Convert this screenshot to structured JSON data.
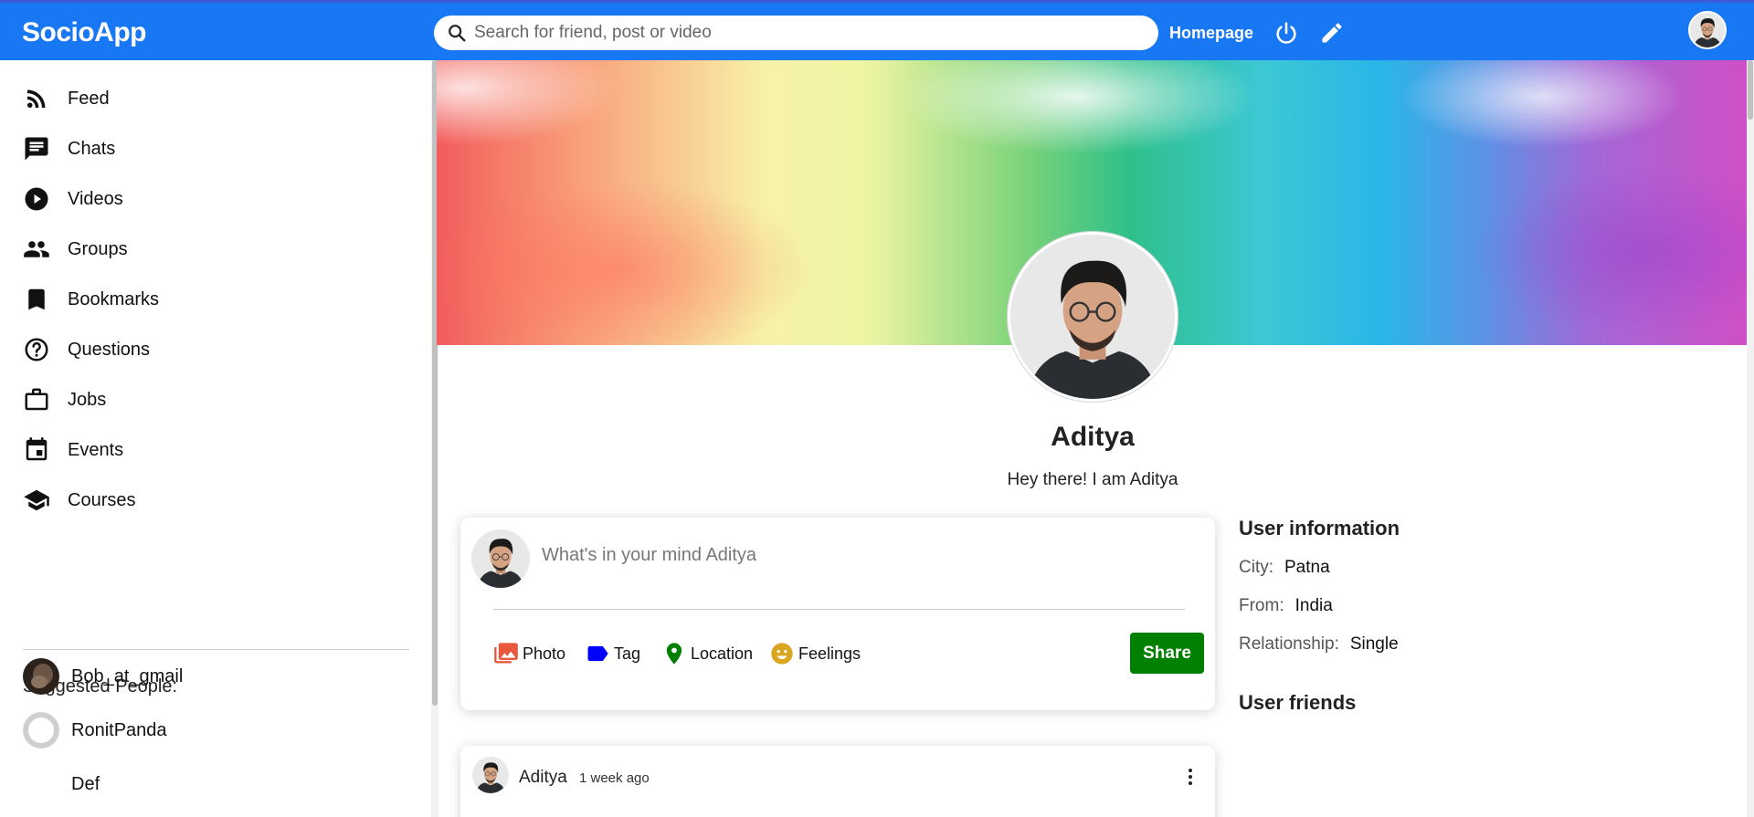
{
  "app": {
    "brand": "SocioApp",
    "search_placeholder": "Search for friend, post or video",
    "nav_link": "Homepage",
    "accent_color": "#1877f2"
  },
  "sidebar": {
    "items": [
      {
        "label": "Feed",
        "icon": "rss-feed-icon"
      },
      {
        "label": "Chats",
        "icon": "chat-icon"
      },
      {
        "label": "Videos",
        "icon": "play-circle-icon"
      },
      {
        "label": "Groups",
        "icon": "group-icon"
      },
      {
        "label": "Bookmarks",
        "icon": "bookmark-icon"
      },
      {
        "label": "Questions",
        "icon": "help-circle-icon"
      },
      {
        "label": "Jobs",
        "icon": "briefcase-icon"
      },
      {
        "label": "Events",
        "icon": "calendar-icon"
      },
      {
        "label": "Courses",
        "icon": "school-icon"
      }
    ],
    "suggested_title": "Suggested People:",
    "suggested": [
      {
        "name": "Bob_at_gmail"
      },
      {
        "name": "RonitPanda"
      },
      {
        "name": "Def"
      }
    ]
  },
  "profile": {
    "name": "Aditya",
    "bio": "Hey there! I am Aditya"
  },
  "share": {
    "placeholder": "What's in your mind Aditya",
    "options": [
      {
        "label": "Photo",
        "icon": "photo-icon",
        "color": "#e9573f"
      },
      {
        "label": "Tag",
        "icon": "tag-icon",
        "color": "#0000ff"
      },
      {
        "label": "Location",
        "icon": "location-pin-icon",
        "color": "#008000"
      },
      {
        "label": "Feelings",
        "icon": "emoji-icon",
        "color": "#daa520"
      }
    ],
    "button": "Share",
    "button_color": "#008000"
  },
  "post": {
    "user": "Aditya",
    "time": "1 week ago"
  },
  "user_info": {
    "title": "User information",
    "fields": [
      {
        "key": "City:",
        "value": "Patna"
      },
      {
        "key": "From:",
        "value": "India"
      },
      {
        "key": "Relationship:",
        "value": "Single"
      }
    ],
    "friends_title": "User friends"
  }
}
